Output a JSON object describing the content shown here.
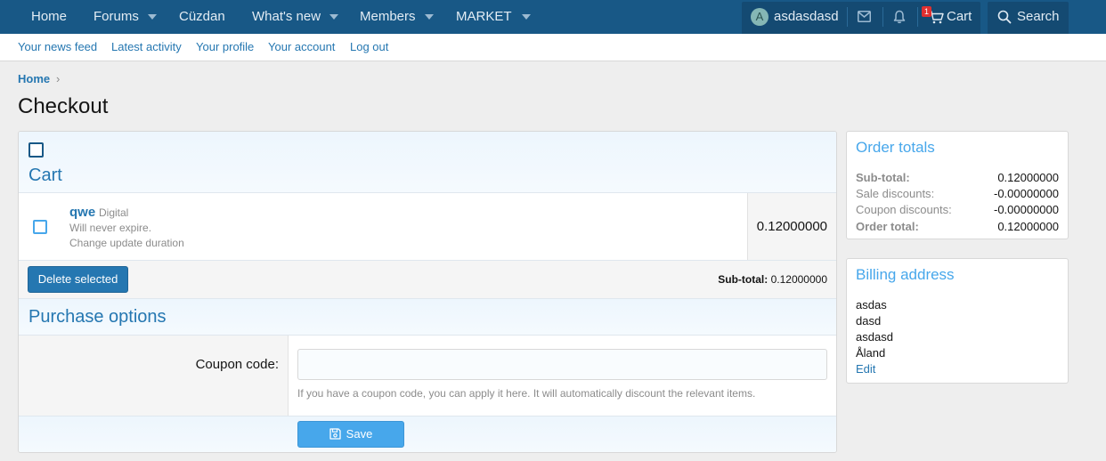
{
  "nav": {
    "items": [
      "Home",
      "Forums",
      "Cüzdan",
      "What's new",
      "Members",
      "MARKET"
    ],
    "username": "asdasdasd",
    "avatar_letter": "A",
    "cart_label": "Cart",
    "cart_badge": "1",
    "search_label": "Search"
  },
  "subnav": {
    "links": [
      "Your news feed",
      "Latest activity",
      "Your profile",
      "Your account",
      "Log out"
    ]
  },
  "breadcrumb": {
    "home": "Home",
    "arrow": "›"
  },
  "page": {
    "title": "Checkout"
  },
  "cart": {
    "title": "Cart",
    "item": {
      "name": "qwe",
      "type": "Digital",
      "expiry": "Will never expire.",
      "change_link": "Change update duration",
      "price": "0.12000000"
    },
    "delete_label": "Delete selected",
    "subtotal_label": "Sub-total:",
    "subtotal_value": "0.12000000"
  },
  "purchase_options": {
    "title": "Purchase options",
    "coupon_label": "Coupon code:",
    "coupon_value": "",
    "coupon_hint": "If you have a coupon code, you can apply it here. It will automatically discount the relevant items.",
    "save_label": "Save"
  },
  "order_totals": {
    "title": "Order totals",
    "rows": [
      {
        "label": "Sub-total",
        "value": "0.12000000"
      },
      {
        "label": "Sale discounts",
        "value": "-0.00000000"
      },
      {
        "label": "Coupon discounts",
        "value": "-0.00000000"
      },
      {
        "label": "Order total",
        "value": "0.12000000"
      }
    ]
  },
  "billing": {
    "title": "Billing address",
    "lines": [
      "asdas",
      "dasd",
      "asdasd",
      "Åland"
    ],
    "edit_label": "Edit"
  },
  "colors": {
    "nav_bg": "#185886",
    "link": "#2577b1",
    "accent": "#47a7eb",
    "button_primary": "#2577b1"
  }
}
